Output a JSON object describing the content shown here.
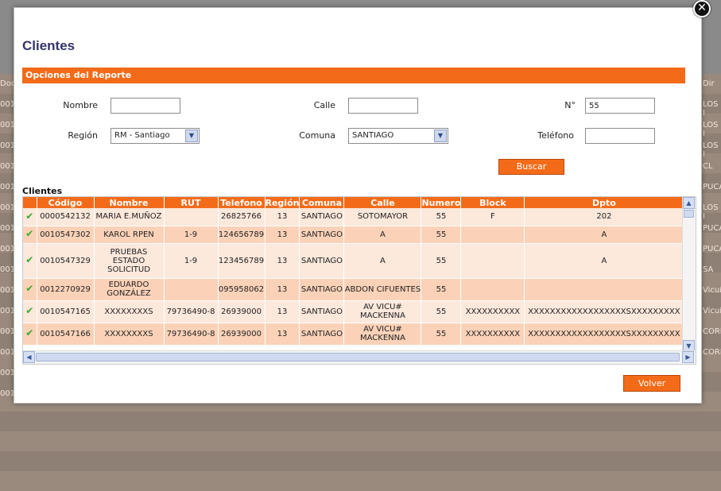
{
  "background": {
    "left_edge_texts": [
      "Doc",
      "001",
      "001",
      "001",
      "001",
      "001",
      "001",
      "001",
      "001",
      "001",
      "001",
      "001",
      "001",
      "001",
      "001",
      "001"
    ],
    "right_edge_texts": [
      "Dir",
      "LOS I",
      "LOS I",
      "LOS I",
      "CL",
      "PUCA",
      "LOS I",
      "PUCA",
      "PUCA",
      "SA",
      "Vicuí",
      "Vicuí",
      "CORD",
      "CORD"
    ]
  },
  "modal": {
    "close_label": "✕",
    "title": "Clientes",
    "section_title": "Opciones del Reporte",
    "form": {
      "nombre_label": "Nombre",
      "nombre_value": "",
      "calle_label": "Calle",
      "calle_value": "",
      "numero_label": "N°",
      "numero_value": "55",
      "region_label": "Región",
      "region_value": "RM - Santiago",
      "comuna_label": "Comuna",
      "comuna_value": "SANTIAGO",
      "telefono_label": "Teléfono",
      "telefono_value": ""
    },
    "search_button": "Buscar",
    "results_title": "Clientes",
    "back_button": "Volver"
  },
  "grid": {
    "columns": [
      "Código",
      "Nombre",
      "RUT",
      "Telefono",
      "Región",
      "Comuna",
      "Calle",
      "Numero",
      "Block",
      "Dpto"
    ],
    "rows": [
      {
        "codigo": "0000542132",
        "nombre": "MARIA E.MUÑOZ",
        "rut": "",
        "telefono": "26825766",
        "region": "13",
        "comuna": "SANTIAGO",
        "calle": "SOTOMAYOR",
        "numero": "55",
        "block": "F",
        "dpto": "202"
      },
      {
        "codigo": "0010547302",
        "nombre": "KAROL RPEN",
        "rut": "1-9",
        "telefono": "124656789",
        "region": "13",
        "comuna": "SANTIAGO",
        "calle": "A",
        "numero": "55",
        "block": "",
        "dpto": "A"
      },
      {
        "codigo": "0010547329",
        "nombre": "PRUEBAS ESTADO SOLICITUD",
        "rut": "1-9",
        "telefono": "123456789",
        "region": "13",
        "comuna": "SANTIAGO",
        "calle": "A",
        "numero": "55",
        "block": "",
        "dpto": "A"
      },
      {
        "codigo": "0012270929",
        "nombre": "EDUARDO GONZÁLEZ",
        "rut": "",
        "telefono": "095958062",
        "region": "13",
        "comuna": "SANTIAGO",
        "calle": "ABDON CIFUENTES",
        "numero": "55",
        "block": "",
        "dpto": ""
      },
      {
        "codigo": "0010547165",
        "nombre": "XXXXXXXXS",
        "rut": "79736490-8",
        "telefono": "26939000",
        "region": "13",
        "comuna": "SANTIAGO",
        "calle": "AV VICU# MACKENNA",
        "numero": "55",
        "block": "XXXXXXXXXX",
        "dpto": "XXXXXXXXXXXXXXXXXXSXXXXXXXXX"
      },
      {
        "codigo": "0010547166",
        "nombre": "XXXXXXXXS",
        "rut": "79736490-8",
        "telefono": "26939000",
        "region": "13",
        "comuna": "SANTIAGO",
        "calle": "AV VICU# MACKENNA",
        "numero": "55",
        "block": "XXXXXXXXXX",
        "dpto": "XXXXXXXXXXXXXXXXXXSXXXXXXXXX"
      }
    ]
  },
  "colors": {
    "accent": "#f36b19",
    "title": "#33336b",
    "row_light": "#fde8dc",
    "row_dark": "#fbd2b8",
    "check": "#3aa62d"
  }
}
